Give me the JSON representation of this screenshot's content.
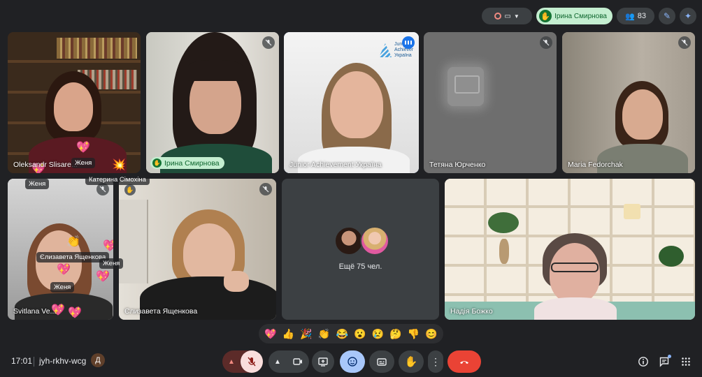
{
  "top_bar": {
    "hand_raised_name": "Ірина Смирнова",
    "participants_count": "83"
  },
  "tiles": [
    {
      "name": "Oleksandr Slisare..."
    },
    {
      "name": "Ірина Смирнова"
    },
    {
      "name": "Junior Achievement Україна",
      "logo_text_1": "Junior",
      "logo_text_2": "Achiever",
      "logo_text_3": "Україна"
    },
    {
      "name": "Тетяна Юрченко"
    },
    {
      "name": "Maria Fedorchak"
    },
    {
      "name": "Svitlana Ve..."
    },
    {
      "name": "Єлизавета Ященкова"
    },
    {
      "name": "Надія Божко"
    }
  ],
  "more_tile": {
    "label": "Ещё 75 чел."
  },
  "reaction_chips": [
    "Женя",
    "Катерина Сімохіна",
    "Женя",
    "Єлизавета Ященкова",
    "Женя",
    "Женя"
  ],
  "emoji_bar": [
    "💖",
    "👍",
    "🎉",
    "👏",
    "😂",
    "😮",
    "😢",
    "🤔",
    "👎",
    "😊"
  ],
  "bottom_bar": {
    "time": "17:01",
    "meeting_code": "jyh-rkhv-wcg",
    "code_badge": "Д"
  },
  "colors": {
    "background": "#202124",
    "end_call": "#ea4335",
    "hand_raised": "#c4eed0",
    "active_blue": "#8ab4f8"
  }
}
